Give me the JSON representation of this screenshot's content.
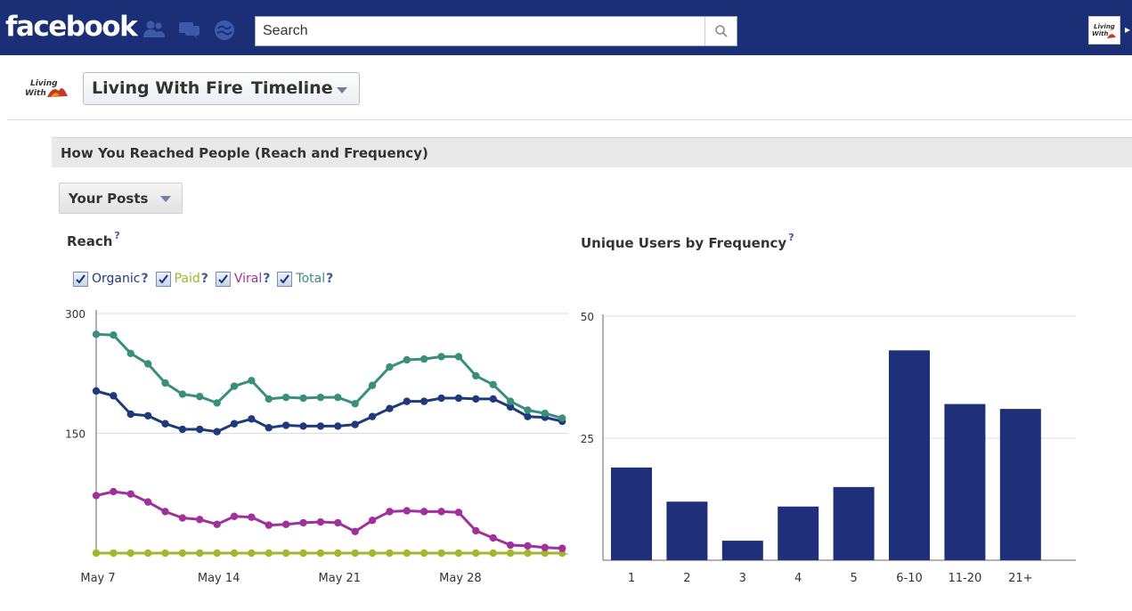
{
  "topbar": {
    "logo_text": "facebook",
    "search_placeholder": "Search",
    "jewels": [
      "friend-requests-icon",
      "messages-icon",
      "notifications-icon"
    ],
    "brand_color": "#1a2f76"
  },
  "page_header": {
    "page_name": "Living With Fire",
    "view_name": "Timeline",
    "logo_text": "Living With Fire"
  },
  "section": {
    "title": "How You Reached People (Reach and Frequency)",
    "posts_filter": "Your Posts"
  },
  "reach_chart": {
    "title": "Reach",
    "help": "?",
    "legend": [
      {
        "label": "Organic",
        "color": "#1f3a7a",
        "checked": true
      },
      {
        "label": "Paid",
        "color": "#a3b62e",
        "checked": true
      },
      {
        "label": "Viral",
        "color": "#a0319a",
        "checked": true
      },
      {
        "label": "Total",
        "color": "#3a8f7a",
        "checked": true
      }
    ]
  },
  "frequency_chart": {
    "title": "Unique Users by Frequency",
    "help": "?"
  },
  "chart_data": [
    {
      "type": "line",
      "title": "Reach",
      "x_labels": [
        "May 7",
        "May 14",
        "May 21",
        "May 28"
      ],
      "x_label_indices": [
        0,
        7,
        14,
        21
      ],
      "ylim": [
        0,
        300
      ],
      "yticks": [
        150,
        300
      ],
      "grid": true,
      "series": [
        {
          "name": "Organic",
          "color": "#1f3a7a",
          "values": [
            203,
            197,
            174,
            172,
            162,
            155,
            155,
            152,
            162,
            168,
            157,
            160,
            159,
            159,
            159,
            161,
            171,
            181,
            190,
            190,
            194,
            194,
            193,
            193,
            183,
            171,
            170,
            165
          ]
        },
        {
          "name": "Paid",
          "color": "#a3b62e",
          "values": [
            0,
            0,
            0,
            0,
            0,
            0,
            0,
            0,
            0,
            0,
            0,
            0,
            0,
            0,
            0,
            0,
            0,
            0,
            0,
            0,
            0,
            0,
            0,
            0,
            0,
            0,
            0,
            0
          ]
        },
        {
          "name": "Viral",
          "color": "#a0319a",
          "values": [
            72,
            77,
            74,
            64,
            52,
            44,
            42,
            36,
            46,
            45,
            35,
            36,
            38,
            39,
            38,
            27,
            41,
            52,
            53,
            52,
            52,
            51,
            28,
            19,
            10,
            9,
            7,
            6
          ]
        },
        {
          "name": "Total",
          "color": "#3a8f7a",
          "values": [
            274,
            273,
            250,
            237,
            213,
            199,
            196,
            188,
            209,
            216,
            193,
            195,
            194,
            195,
            195,
            187,
            210,
            233,
            242,
            243,
            246,
            246,
            222,
            211,
            190,
            179,
            175,
            169
          ]
        }
      ]
    },
    {
      "type": "bar",
      "title": "Unique Users by Frequency",
      "categories": [
        "1",
        "2",
        "3",
        "4",
        "5",
        "6-10",
        "11-20",
        "21+"
      ],
      "values": [
        19,
        12,
        4,
        11,
        15,
        43,
        32,
        31
      ],
      "ylim": [
        0,
        50
      ],
      "yticks": [
        25,
        50
      ],
      "grid": true,
      "color": "#1f2f7a"
    }
  ]
}
